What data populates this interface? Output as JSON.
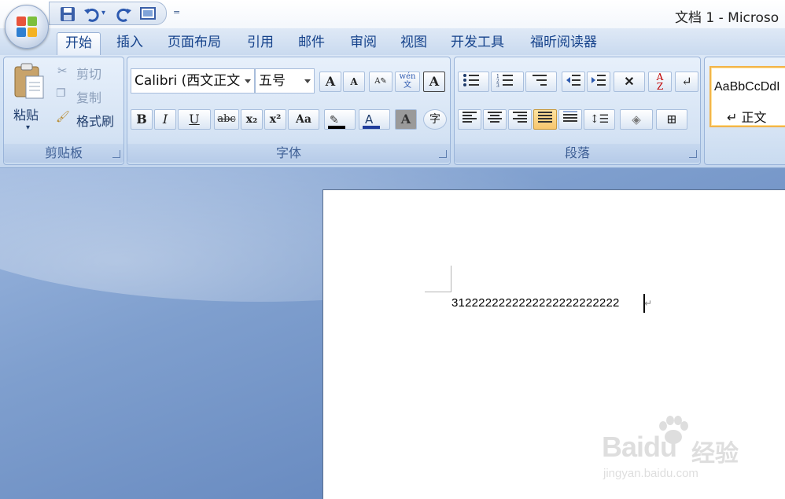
{
  "window": {
    "title": "文档 1 - Microso"
  },
  "quick_access": {
    "items": [
      "save-icon",
      "undo-icon",
      "redo-icon",
      "print-preview-icon"
    ],
    "customize": "="
  },
  "tabs": [
    {
      "label": "开始",
      "active": true
    },
    {
      "label": "插入"
    },
    {
      "label": "页面布局"
    },
    {
      "label": "引用"
    },
    {
      "label": "邮件"
    },
    {
      "label": "审阅"
    },
    {
      "label": "视图"
    },
    {
      "label": "开发工具"
    },
    {
      "label": "福昕阅读器"
    }
  ],
  "clipboard": {
    "group_label": "剪贴板",
    "paste": "粘贴",
    "cut": "剪切",
    "copy": "复制",
    "format_painter": "格式刷"
  },
  "font": {
    "group_label": "字体",
    "font_name": "Calibri (西文正文",
    "font_size": "五号",
    "bold": "B",
    "italic": "I",
    "underline": "U",
    "strikethrough": "abc",
    "subscript": "x₂",
    "superscript": "x²",
    "change_case": "Aa",
    "grow": "A",
    "shrink": "A",
    "phonetic": "wén 文",
    "char_border": "A",
    "char_shading": "A",
    "enclose": "字"
  },
  "paragraph": {
    "group_label": "段落"
  },
  "styles": {
    "sample": "AaBbCcDdI",
    "normal": "↵ 正文"
  },
  "document": {
    "text": "3122222222222222222222222"
  },
  "watermark": {
    "logo": "Baidu",
    "cn": "经验",
    "url": "jingyan.baidu.com"
  },
  "colors": {
    "accent": "#15428b",
    "highlight": "#ffff00",
    "font_color": "#c00000",
    "active_align": "#f7c66e"
  }
}
